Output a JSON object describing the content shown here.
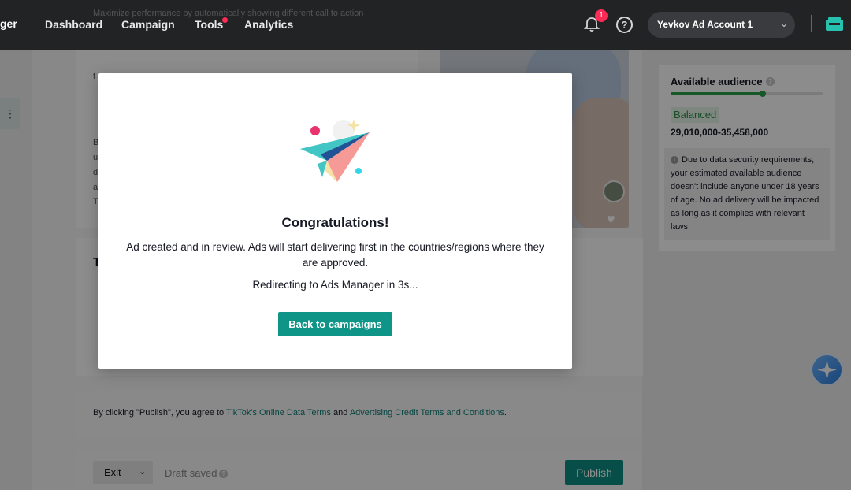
{
  "topbar": {
    "brand_fragment": "ger",
    "nav": [
      "Dashboard",
      "Campaign",
      "Tools",
      "Analytics"
    ],
    "notification_count": "1",
    "help_glyph": "?",
    "account_name": "Yevkov Ad Account 1",
    "icons": [
      "bell-icon",
      "help-icon",
      "chevron-down-icon",
      "shop-icon"
    ]
  },
  "background": {
    "card_text": "Maximize performance by automatically showing different call to action",
    "frag_t": "t",
    "frag_b": "B",
    "frag_u": "u",
    "frag_d": "d",
    "frag_a": "a",
    "frag_T1": "T",
    "section_frag": "T",
    "audience": {
      "title": "Available audience",
      "fill_fraction": 0.6,
      "status": "Balanced",
      "range": "29,010,000-35,458,000",
      "note": "Due to data security requirements, your estimated available audience doesn't include anyone under 18 years of age. No ad delivery will be impacted as long as it complies with relevant laws."
    },
    "terms": {
      "prefix": "By clicking \"Publish\", you agree to ",
      "link1": "TikTok's Online Data Terms",
      "middle": " and ",
      "link2": "Advertising Credit Terms and Conditions",
      "suffix": "."
    },
    "bottom": {
      "exit": "Exit",
      "draft": "Draft saved",
      "publish": "Publish"
    }
  },
  "modal": {
    "title": "Congratulations!",
    "message": "Ad created and in review. Ads will start delivering first in the countries/regions where they are approved.",
    "redirect": "Redirecting to Ads Manager in 3s...",
    "button": "Back to campaigns"
  },
  "colors": {
    "accent": "#0f9488",
    "topbar": "#222325",
    "alert": "#fe2c55",
    "balanced": "#2aa14a"
  }
}
